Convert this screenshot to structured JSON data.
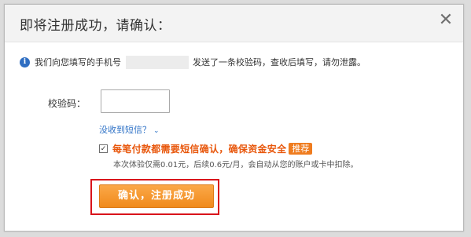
{
  "dialog": {
    "title": "即将注册成功，请确认：",
    "close_icon": "close-icon"
  },
  "info": {
    "icon": "info-icon",
    "prefix": "我们向您填写的手机号",
    "suffix": "发送了一条校验码，查收后填写，请勿泄露。"
  },
  "form": {
    "code_label": "校验码：",
    "code_value": "",
    "no_sms_link": "没收到短信？",
    "no_sms_chevron": "chevron-down-icon"
  },
  "sms_option": {
    "checked": true,
    "label": "每笔付款都需要短信确认，确保资金安全",
    "badge": "推荐",
    "note": "本次体验仅需0.01元，后续0.6元/月，会自动从您的账户或卡中扣除。"
  },
  "actions": {
    "confirm_label": "确认，注册成功"
  },
  "colors": {
    "accent_orange": "#f08a1c",
    "link_blue": "#2d71c6",
    "warning_text": "#e8570c",
    "highlight_red": "#d9141b"
  }
}
